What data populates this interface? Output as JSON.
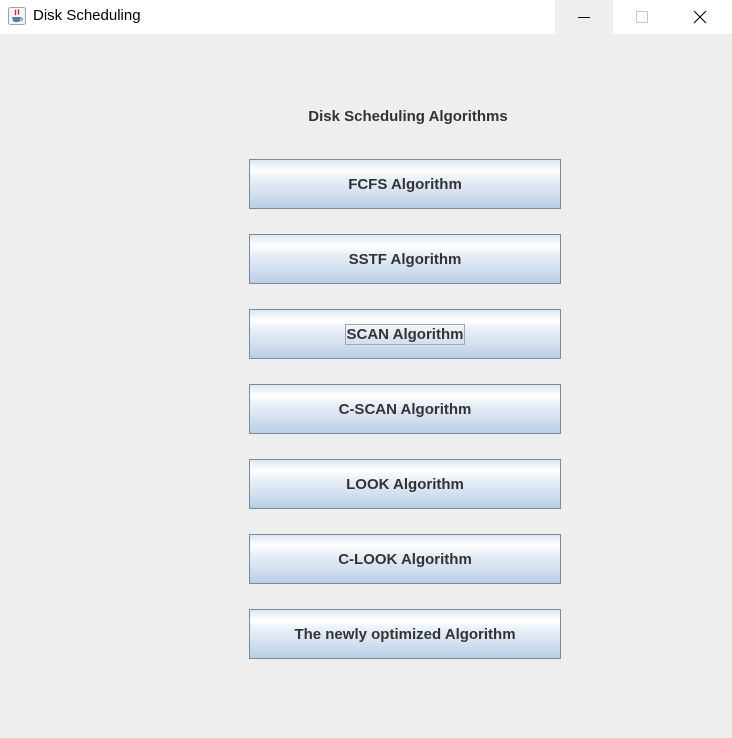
{
  "window": {
    "title": "Disk Scheduling",
    "icons": {
      "app": "java-icon",
      "minimize": "minimize-icon",
      "maximize": "maximize-icon",
      "close": "close-icon"
    }
  },
  "main": {
    "heading": "Disk Scheduling Algorithms",
    "buttons": [
      {
        "label": "FCFS Algorithm"
      },
      {
        "label": "SSTF Algorithm"
      },
      {
        "label": "SCAN Algorithm",
        "focused": true
      },
      {
        "label": "C-SCAN Algorithm"
      },
      {
        "label": "LOOK Algorithm"
      },
      {
        "label": "C-LOOK Algorithm"
      },
      {
        "label": "The newly optimized Algorithm"
      }
    ]
  },
  "colors": {
    "background": "#eeeeee",
    "text": "#333333",
    "button_border": "#7a8a99"
  }
}
